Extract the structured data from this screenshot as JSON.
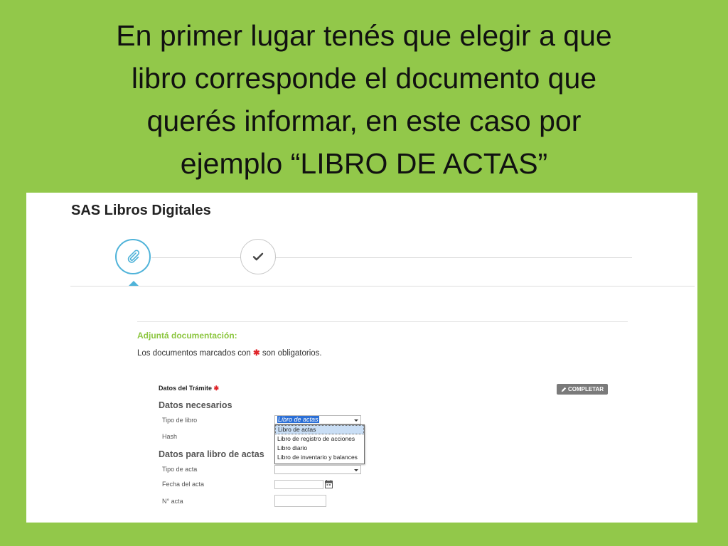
{
  "slide": {
    "heading_lines": [
      "En primer lugar tenés que elegir a que",
      "libro corresponde el documento que",
      "querés informar, en este caso por",
      "ejemplo “LIBRO DE ACTAS”"
    ],
    "background_color": "#92c84a"
  },
  "app": {
    "title": "SAS Libros Digitales",
    "accent_color": "#4fb3d9",
    "steps": [
      {
        "icon": "paperclip-icon",
        "active": true
      },
      {
        "icon": "check-icon",
        "active": false
      }
    ]
  },
  "form": {
    "section_heading": "Adjuntá documentación:",
    "required_note_prefix": "Los documentos marcados con",
    "required_star": "✱",
    "required_note_suffix": "son obligatorios.",
    "tramite_label": "Datos del Trámite",
    "completar_label": "COMPLETAR",
    "datos_necesarios": "Datos necesarios",
    "tipo_libro_label": "Tipo de libro",
    "tipo_libro_value": "Libro de actas",
    "hash_label": "Hash",
    "dropdown_options": [
      "Libro de actas",
      "Libro de registro de acciones",
      "Libro diario",
      "Libro de inventario y balances"
    ],
    "datos_actas": "Datos para libro de actas",
    "tipo_acta_label": "Tipo de acta",
    "fecha_acta_label": "Fecha del acta",
    "nro_acta_label": "N° acta"
  }
}
